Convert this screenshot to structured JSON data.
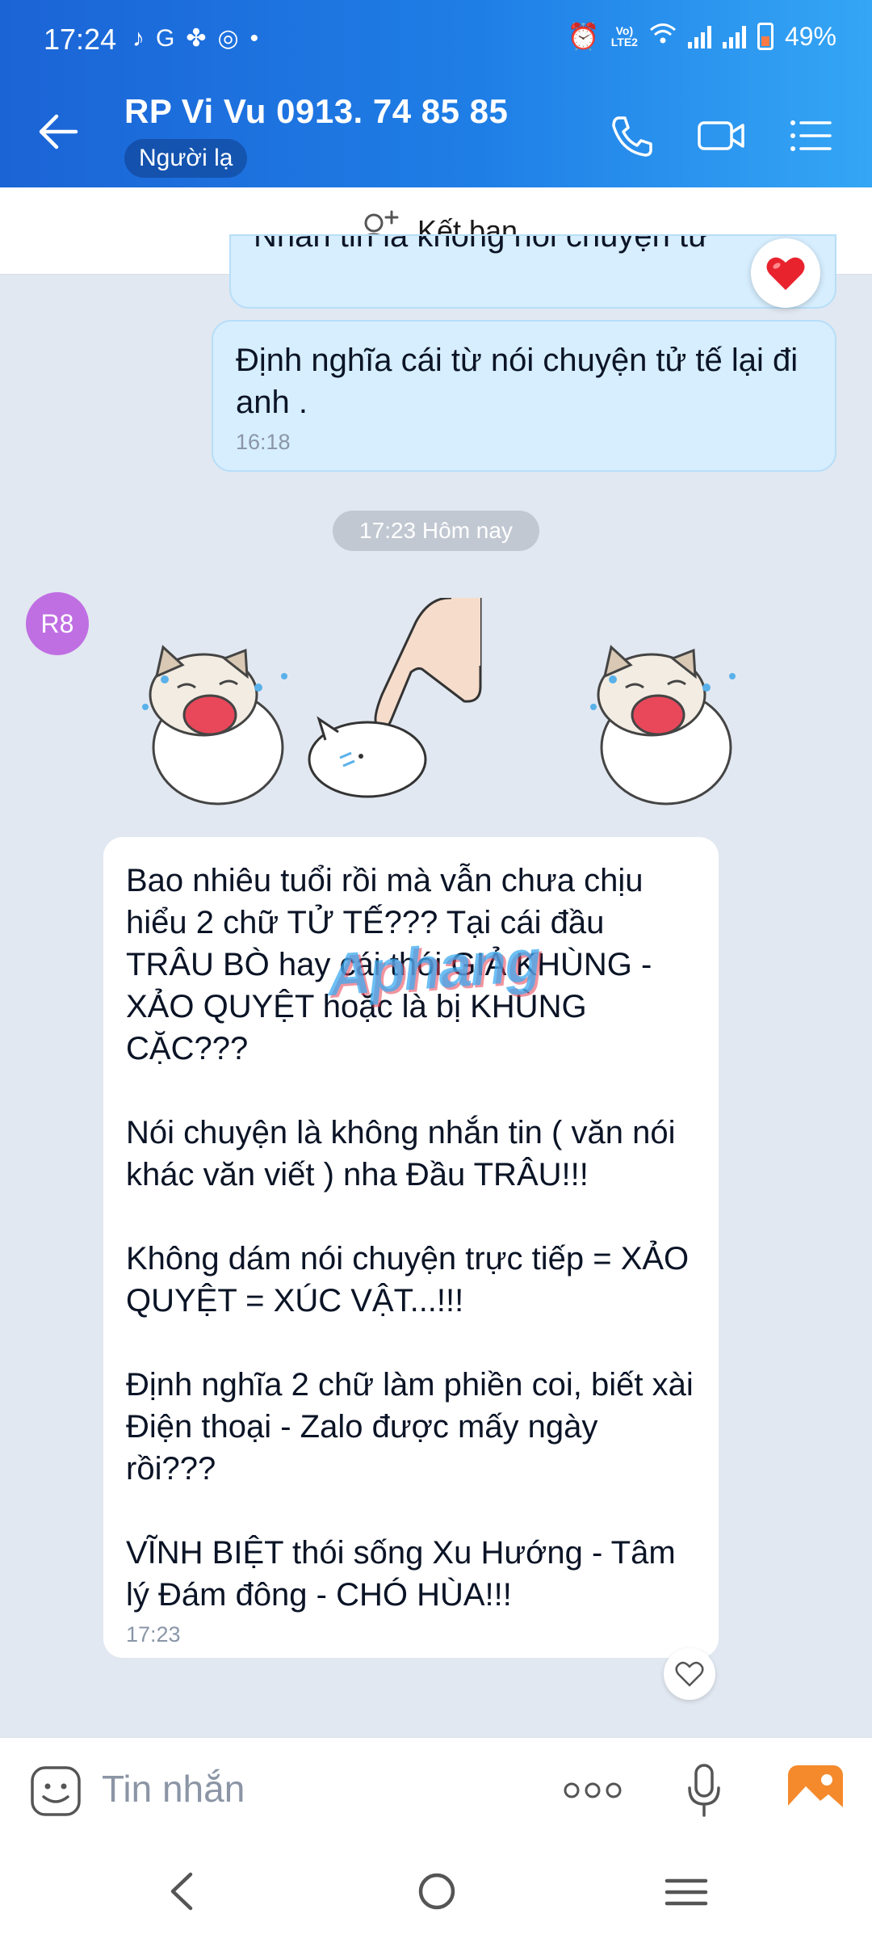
{
  "status": {
    "time": "17:24",
    "network_label": "Vo) LTE2",
    "battery": "49%"
  },
  "header": {
    "contact_name": "RP Vi Vu 0913. 74 85 85",
    "badge": "Người lạ"
  },
  "add_friend": {
    "label": "Kết bạn"
  },
  "messages": {
    "partial_sent_text": "Nhắn tin là không nói chuyện tử",
    "sent": {
      "text": "Định nghĩa cái từ nói chuyện tử tế lại đi anh .",
      "time": "16:18"
    },
    "date_separator": "17:23 Hôm nay",
    "sender_avatar": "R8",
    "received": {
      "paragraphs": [
        "Bao nhiêu tuổi rồi mà vẫn chưa chịu hiểu 2 chữ TỬ TẾ??? Tại cái đầu TRÂU BÒ hay cái thói GIẢ KHÙNG - XẢO QUYỆT hoặc là bị KHÙNG CẶC???",
        "Nói chuyện là không nhắn tin ( văn nói khác văn viết ) nha Đầu TRÂU!!!",
        "Không dám nói chuyện trực tiếp = XẢO QUYỆT = XÚC VẬT...!!!",
        "Định nghĩa 2 chữ làm phiền coi, biết xài Điện thoại - Zalo được mấy ngày rồi???",
        "VĨNH BIỆT thói sống Xu Hướng - Tâm lý Đám đông - CHÓ HÙA!!!"
      ],
      "time": "17:23"
    },
    "watermark": "Aphang"
  },
  "composer": {
    "placeholder": "Tin nhắn"
  },
  "colors": {
    "header_start": "#1b64d6",
    "header_end": "#34a6f5",
    "sent_bubble": "#d6eefe",
    "avatar": "#c06fe3"
  }
}
